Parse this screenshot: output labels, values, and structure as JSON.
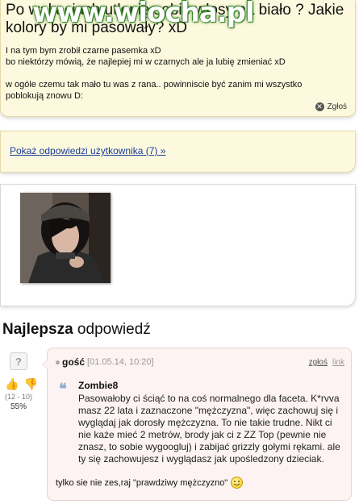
{
  "question": {
    "title": "Po wakacjach utlenię sobie włosy na biało ? Jakie kolory by mi pasowały? xD",
    "body_lines": [
      "I na tym bym zrobił czarne pasemka xD",
      "bo niektórzy mówią, że najlepiej mi w czarnych ale ja lubię zmieniać xD",
      "w ogóle czemu tak mało tu was z rana.. powinniscie być zanim mi wszystko",
      "poblokują znowu D:"
    ],
    "report_label": "Zgłoś"
  },
  "watermark": "www.wiocha.pl",
  "user_answers_link": "Pokaż odpowiedzi użytkownika (7) »",
  "best_answer": {
    "heading_bold": "Najlepsza",
    "heading_rest": " odpowiedź",
    "votes": {
      "count": "(12 - 10)",
      "percent": "55%"
    },
    "author": "gość",
    "date": "[01.05.14, 10:20]",
    "report_label": "zgłoś",
    "link_label": "link",
    "quote_author": "Zombie8",
    "quote_text": "Pasowałoby ci ściąć to na coś normalnego dla faceta. K*rvva masz 22 lata i zaznaczone \"mężczyzna\", więc zachowuj się i wyglądaj jak dorosły mężczyzna. To nie takie trudne. Nikt ci nie każe mieć 2 metrów, brody jak ci z ZZ Top (pewnie nie znasz, to sobie wygoogluj) i zabijać grizzly gołymi rękami. ale ty się zachowujesz i wyglądasz jak upośledzony dzieciak.",
    "reply_text": "tylko sie nie zes,raj \"prawdziwy mężczyzno\""
  },
  "colors": {
    "card_bg": "#fdf9de",
    "answer_bg": "#fdf3f2",
    "link": "#1a3d9b",
    "watermark_glow": "#2e7d1f"
  },
  "icons": [
    "report-icon",
    "avatar-icon",
    "thumb-up-icon",
    "thumb-down-icon",
    "quote-icon",
    "smiley-icon"
  ]
}
